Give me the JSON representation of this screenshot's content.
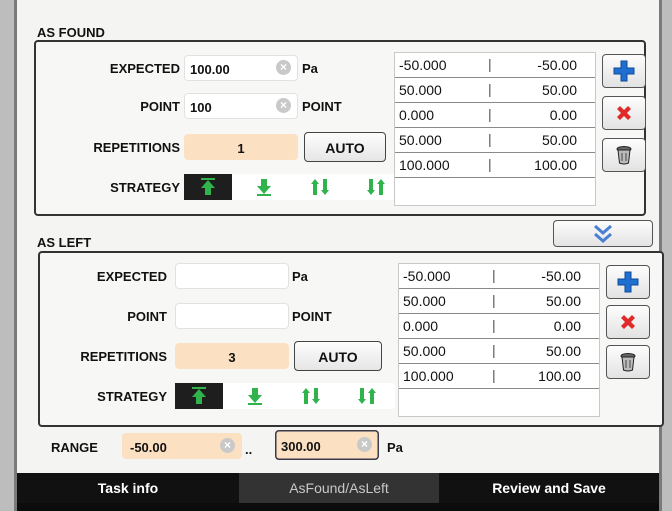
{
  "as_found": {
    "title": "AS FOUND",
    "expected_label": "EXPECTED",
    "expected_value": "100.00",
    "expected_unit": "Pa",
    "point_label": "POINT",
    "point_value": "100",
    "point_unit": "POINT",
    "repetitions_label": "REPETITIONS",
    "repetitions_value": "1",
    "auto_label": "AUTO",
    "strategy_label": "STRATEGY",
    "strategy_active": "up",
    "points": [
      {
        "a": "-50.000",
        "b": "-50.00"
      },
      {
        "a": "50.000",
        "b": "50.00"
      },
      {
        "a": "0.000",
        "b": "0.00"
      },
      {
        "a": "50.000",
        "b": "50.00"
      },
      {
        "a": "100.000",
        "b": "100.00"
      }
    ]
  },
  "as_left": {
    "title": "AS LEFT",
    "expected_label": "EXPECTED",
    "expected_value": "",
    "expected_unit": "Pa",
    "point_label": "POINT",
    "point_value": "",
    "point_unit": "POINT",
    "repetitions_label": "REPETITIONS",
    "repetitions_value": "3",
    "auto_label": "AUTO",
    "strategy_label": "STRATEGY",
    "strategy_active": "up",
    "points": [
      {
        "a": "-50.000",
        "b": "-50.00"
      },
      {
        "a": "50.000",
        "b": "50.00"
      },
      {
        "a": "0.000",
        "b": "0.00"
      },
      {
        "a": "50.000",
        "b": "50.00"
      },
      {
        "a": "100.000",
        "b": "100.00"
      }
    ]
  },
  "range": {
    "label": "RANGE",
    "min": "-50.00",
    "separator": "..",
    "max": "300.00",
    "unit": "Pa"
  },
  "separator_char": "|",
  "clear_glyph": "×",
  "icons": {
    "add": "plus-icon",
    "delete": "x-icon",
    "trash": "trash-icon",
    "toggle": "double-chevron-down-icon",
    "strategy": [
      "arrow-up-icon",
      "arrow-down-icon",
      "arrows-up-down-icon",
      "arrows-down-up-icon"
    ]
  },
  "colors": {
    "peach": "#fce0c2",
    "green_arrow": "#2fb34a",
    "add_blue": "#1e6fd0",
    "delete_red": "#e02a2a",
    "toggle_blue": "#4a7fd6"
  },
  "tabs": [
    {
      "label": "Task info",
      "active": false
    },
    {
      "label": "AsFound/AsLeft",
      "active": true
    },
    {
      "label": "Review and Save",
      "active": false
    }
  ]
}
